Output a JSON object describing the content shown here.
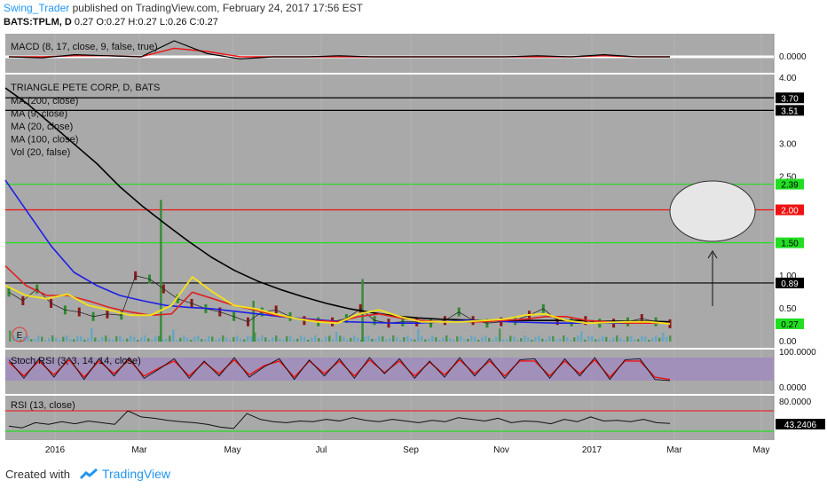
{
  "header": {
    "user": "Swing_Trader",
    "published": " published on TradingView.com, February 24, 2017 17:56 EST",
    "symbol": "BATS:TPLM, D",
    "ohlc": " 0.27 O:0.27 H:0.27 L:0.26 C:0.27"
  },
  "footer": {
    "created_with": "Created with",
    "brand": "TradingView"
  },
  "colors": {
    "panel_bg": "#a9a9a9",
    "ma200": "#000000",
    "ma100": "#1e1ee6",
    "ma20": "#e02020",
    "ma9": "#f0e020",
    "green_line": "#22dd22",
    "red_line": "#ee1111",
    "stoch_band": "#9e86c0",
    "price_candle_up": "#2e8b2e",
    "price_candle_down": "#8b1a1a"
  },
  "chart_data": [
    {
      "type": "line",
      "panel": "macd",
      "title": "MACD (8, 17, close, 9, false, true)",
      "ytick_labels": [
        "0.0000"
      ],
      "series": [
        {
          "name": "MACD",
          "values": [
            0.0,
            -0.01,
            0.02,
            0.01,
            0.0,
            0.15,
            0.03,
            -0.02,
            0.0,
            0.0,
            0.01,
            0.0,
            0.0,
            0.0,
            0.0,
            0.0,
            0.01,
            0.0,
            0.02,
            0.0,
            0.0
          ]
        },
        {
          "name": "Signal",
          "values": [
            0.0,
            0.0,
            0.01,
            0.01,
            0.0,
            0.08,
            0.05,
            0.0,
            0.0,
            0.0,
            0.0,
            0.0,
            0.0,
            0.0,
            0.0,
            0.0,
            0.0,
            0.0,
            0.01,
            0.0,
            0.0
          ]
        }
      ]
    },
    {
      "type": "line",
      "panel": "price",
      "title": "TRIANGLE PETE CORP, D, BATS",
      "legend": [
        "MA (200, close)",
        "MA (9, close)",
        "MA (20, close)",
        "MA (100, close)",
        "Vol (20, false)"
      ],
      "ylim": [
        0,
        4
      ],
      "ytick_labels": [
        "4.00",
        "3.50",
        "3.00",
        "2.50",
        "2.00",
        "1.50",
        "1.00",
        "0.50",
        "0.00"
      ],
      "price_tags": [
        {
          "label": "3.70",
          "value": 3.7,
          "color": "black"
        },
        {
          "label": "3.51",
          "value": 3.51,
          "color": "black"
        },
        {
          "label": "2.39",
          "value": 2.39,
          "color": "green"
        },
        {
          "label": "2.00",
          "value": 2.0,
          "color": "red"
        },
        {
          "label": "1.50",
          "value": 1.5,
          "color": "green"
        },
        {
          "label": "0.89",
          "value": 0.89,
          "color": "black"
        },
        {
          "label": "0.27",
          "value": 0.27,
          "color": "green"
        }
      ],
      "xtick_labels": [
        "2016",
        "Mar",
        "May",
        "Jul",
        "Sep",
        "Nov",
        "2017",
        "Mar",
        "May"
      ],
      "series": [
        {
          "name": "Price",
          "values": [
            0.75,
            0.62,
            0.8,
            0.58,
            0.48,
            0.45,
            0.38,
            0.42,
            0.4,
            1.0,
            0.95,
            0.8,
            0.65,
            0.58,
            0.5,
            0.45,
            0.38,
            0.3,
            0.45,
            0.48,
            0.38,
            0.32,
            0.3,
            0.3,
            0.35,
            0.5,
            0.32,
            0.28,
            0.3,
            0.3,
            0.28,
            0.32,
            0.45,
            0.32,
            0.28,
            0.3,
            0.32,
            0.4,
            0.5,
            0.32,
            0.3,
            0.32,
            0.28,
            0.28,
            0.3,
            0.35,
            0.3,
            0.27
          ]
        },
        {
          "name": "MA (200, close)",
          "values": [
            3.85,
            3.6,
            3.3,
            3.0,
            2.7,
            2.35,
            2.05,
            1.78,
            1.52,
            1.28,
            1.08,
            0.92,
            0.79,
            0.68,
            0.58,
            0.5,
            0.44,
            0.39,
            0.36,
            0.34,
            0.33,
            0.32,
            0.32,
            0.32,
            0.32,
            0.32,
            0.31,
            0.31,
            0.31,
            0.3
          ]
        },
        {
          "name": "MA (100, close)",
          "values": [
            2.45,
            1.95,
            1.45,
            1.05,
            0.85,
            0.7,
            0.62,
            0.55,
            0.52,
            0.5,
            0.46,
            0.42,
            0.38,
            0.35,
            0.32,
            0.3,
            0.29,
            0.28,
            0.28,
            0.3,
            0.32,
            0.32,
            0.3,
            0.29,
            0.28,
            0.28,
            0.28,
            0.28,
            0.28,
            0.28
          ]
        },
        {
          "name": "MA (20, close)",
          "values": [
            1.15,
            0.85,
            0.7,
            0.7,
            0.62,
            0.52,
            0.45,
            0.4,
            0.42,
            0.75,
            0.65,
            0.55,
            0.48,
            0.4,
            0.35,
            0.32,
            0.3,
            0.38,
            0.42,
            0.36,
            0.32,
            0.3,
            0.3,
            0.3,
            0.32,
            0.34,
            0.38,
            0.38,
            0.32,
            0.3,
            0.28,
            0.28,
            0.28
          ]
        },
        {
          "name": "MA (9, close)",
          "values": [
            0.85,
            0.7,
            0.65,
            0.72,
            0.55,
            0.48,
            0.4,
            0.4,
            0.55,
            0.98,
            0.75,
            0.55,
            0.5,
            0.42,
            0.35,
            0.3,
            0.28,
            0.42,
            0.48,
            0.38,
            0.3,
            0.3,
            0.3,
            0.32,
            0.34,
            0.4,
            0.42,
            0.32,
            0.28,
            0.29,
            0.3,
            0.3,
            0.27
          ]
        }
      ],
      "volume_spikes": [
        {
          "x": 0.23,
          "value": 2.15
        },
        {
          "x": 0.535,
          "value": 0.95
        },
        {
          "x": 0.37,
          "value": 0.62
        }
      ]
    },
    {
      "type": "line",
      "panel": "stoch_rsi",
      "title": "Stoch RSI (3, 3, 14, 14, close)",
      "ylim": [
        0,
        100
      ],
      "ytick_labels": [
        "100.0000",
        "0.0000"
      ],
      "series": [
        {
          "name": "K",
          "values": [
            90,
            10,
            95,
            15,
            100,
            5,
            95,
            20,
            100,
            10,
            50,
            95,
            10,
            85,
            20,
            100,
            15,
            60,
            95,
            5,
            90,
            20,
            95,
            10,
            100,
            30,
            95,
            10,
            85,
            15,
            100,
            20,
            95,
            10,
            90,
            95,
            10,
            95,
            20,
            100,
            5,
            90,
            95,
            5,
            0
          ]
        },
        {
          "name": "D",
          "values": [
            80,
            20,
            85,
            25,
            90,
            15,
            85,
            30,
            90,
            20,
            55,
            85,
            20,
            80,
            30,
            90,
            25,
            65,
            85,
            15,
            85,
            30,
            85,
            20,
            90,
            35,
            85,
            20,
            80,
            25,
            90,
            30,
            85,
            20,
            85,
            85,
            20,
            85,
            30,
            90,
            15,
            85,
            85,
            15,
            5
          ]
        }
      ]
    },
    {
      "type": "line",
      "panel": "rsi",
      "title": "RSI (13, close)",
      "ytick_labels": [
        "80.0000",
        "43.2406"
      ],
      "series": [
        {
          "name": "RSI",
          "values": [
            35,
            30,
            45,
            40,
            48,
            42,
            50,
            45,
            40,
            80,
            62,
            58,
            52,
            48,
            45,
            40,
            32,
            28,
            72,
            55,
            48,
            45,
            50,
            48,
            55,
            50,
            60,
            52,
            48,
            55,
            50,
            45,
            52,
            48,
            60,
            55,
            50,
            58,
            45,
            50,
            48,
            42,
            55,
            48,
            62,
            50,
            52,
            48,
            55,
            45,
            43
          ]
        }
      ]
    }
  ]
}
